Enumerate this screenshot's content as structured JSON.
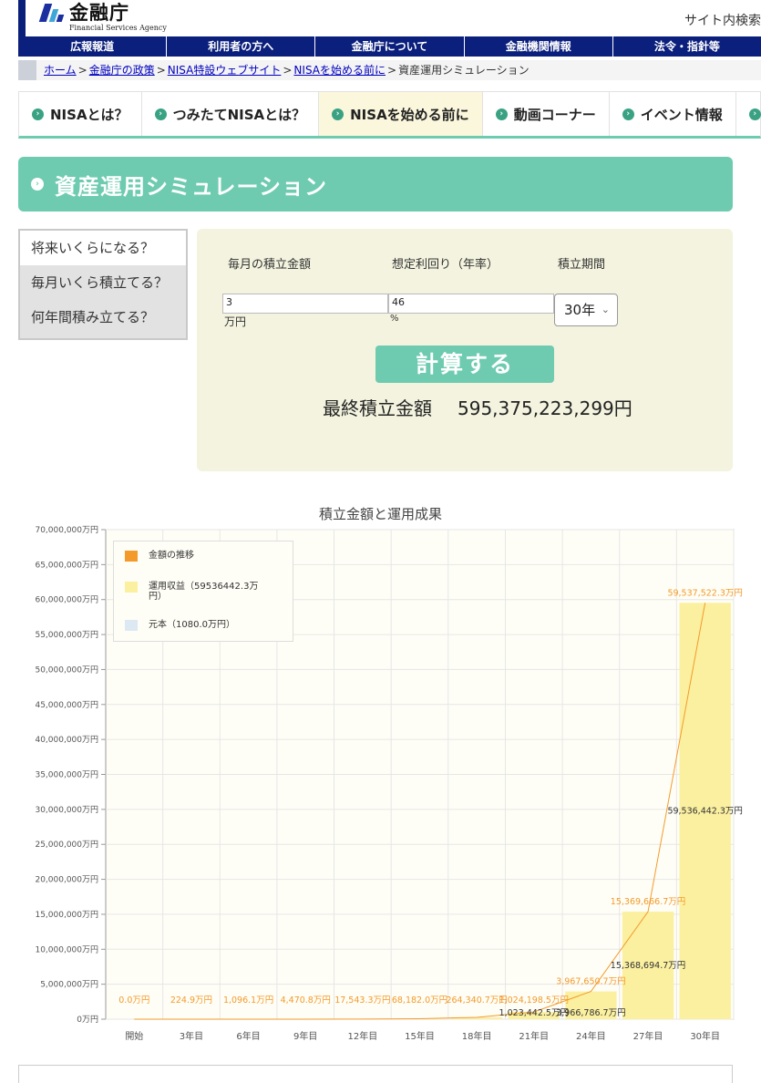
{
  "header": {
    "logo_title": "金融庁",
    "logo_sub": "Financial Services Agency",
    "site_search": "サイト内検索"
  },
  "topnav": [
    "広報報道",
    "利用者の方へ",
    "金融庁について",
    "金融機関情報",
    "法令・指針等"
  ],
  "breadcrumb": {
    "links": [
      "ホーム",
      "金融庁の政策",
      "NISA特設ウェブサイト",
      "NISAを始める前に"
    ],
    "current": "資産運用シミュレーション",
    "separator": ">"
  },
  "tabs": [
    "NISAとは？",
    "つみたてNISAとは？",
    "NISAを始める前に",
    "動画コーナー",
    "イベント情報"
  ],
  "active_tab": 2,
  "page_title": "資産運用シミュレーション",
  "side_menu": [
    "将来いくらになる？",
    "毎月いくら積立てる？",
    "何年間積み立てる？"
  ],
  "form": {
    "monthly_label": "毎月の積立金額",
    "rate_label": "想定利回り（年率）",
    "period_label": "積立期間",
    "monthly_value": "3",
    "monthly_unit": "万円",
    "rate_value": "46",
    "rate_unit": "%",
    "period_value": "30年",
    "calc_button": "計算する",
    "result_label": "最終積立金額",
    "result_value": "595,375,223,299円"
  },
  "colors": {
    "accent": "#6ecbb0",
    "nav": "#0b1f7c",
    "line": "#f39a2b",
    "profit": "#fbf0a0",
    "principal": "#dce9f3"
  },
  "chart_data": {
    "type": "bar",
    "title": "積立金額と運用成果",
    "categories": [
      "開始",
      "3年目",
      "6年目",
      "9年目",
      "12年目",
      "15年目",
      "18年目",
      "21年目",
      "24年目",
      "27年目",
      "30年目"
    ],
    "y_ticks": [
      "0万円",
      "5,000,000万円",
      "10,000,000万円",
      "15,000,000万円",
      "20,000,000万円",
      "25,000,000万円",
      "30,000,000万円",
      "35,000,000万円",
      "40,000,000万円",
      "45,000,000万円",
      "50,000,000万円",
      "55,000,000万円",
      "60,000,000万円",
      "65,000,000万円",
      "70,000,000万円"
    ],
    "ylim": [
      0,
      70000000
    ],
    "legend": [
      "金額の推移",
      "運用収益（59536442.3万円）",
      "元本（1080.0万円）"
    ],
    "series": [
      {
        "name": "金額の推移",
        "values": [
          0,
          224.9,
          1096.1,
          4470.8,
          17543.3,
          68182,
          264340.7,
          1024198.5,
          3967650.7,
          15369666.7,
          59537522.3
        ],
        "labels": [
          "0.0万円",
          "224.9万円",
          "1,096.1万円",
          "4,470.8万円",
          "17,543.3万円",
          "68,182.0万円",
          "264,340.7万円",
          "1,024,198.5万円",
          "3,967,650.7万円",
          "15,369,666.7万円",
          "59,537,522.3万円"
        ]
      },
      {
        "name": "運用収益",
        "values": [
          0,
          116.9,
          880.1,
          4146.8,
          17111.3,
          67642,
          263692.7,
          1023442.5,
          3966786.7,
          15368694.7,
          59536442.3
        ],
        "labels": [
          "",
          "",
          "",
          "",
          "",
          "",
          "",
          "1,023,442.5万円",
          "3,966,786.7万円",
          "15,368,694.7万円",
          "59,536,442.3万円"
        ]
      },
      {
        "name": "元本",
        "values": [
          0,
          108,
          216,
          324,
          432,
          540,
          648,
          756,
          864,
          972,
          1080
        ]
      }
    ]
  }
}
